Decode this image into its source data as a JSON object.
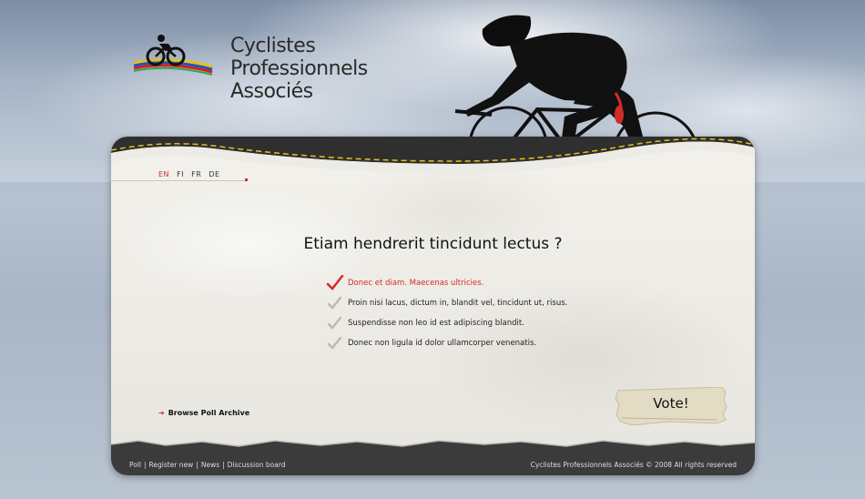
{
  "header": {
    "logo_lines": [
      "Cyclistes",
      "Professionnels",
      "Associés"
    ]
  },
  "languages": [
    {
      "code": "EN",
      "active": true
    },
    {
      "code": "FI",
      "active": false
    },
    {
      "code": "FR",
      "active": false
    },
    {
      "code": "DE",
      "active": false
    }
  ],
  "poll": {
    "question": "Etiam hendrerit tincidunt lectus ?",
    "options": [
      {
        "label": "Donec et diam. Maecenas ultricies.",
        "selected": true
      },
      {
        "label": "Proin nisi lacus, dictum in, blandit vel, tincidunt ut, risus.",
        "selected": false
      },
      {
        "label": "Suspendisse non leo id est adipiscing blandit.",
        "selected": false
      },
      {
        "label": "Donec non ligula id dolor ullamcorper venenatis.",
        "selected": false
      }
    ],
    "vote_label": "Vote!"
  },
  "archive_link": "Browse Poll Archive",
  "footer": {
    "links": [
      "Poll",
      "Register new",
      "News",
      "Discussion board"
    ],
    "separator": "|",
    "copyright": "Cyclistes Professionnels Associés  © 2008 All rights reserved"
  },
  "colors": {
    "accent": "#d42b2b",
    "road": "#3b3b3b",
    "road_line": "#e3c21a"
  }
}
